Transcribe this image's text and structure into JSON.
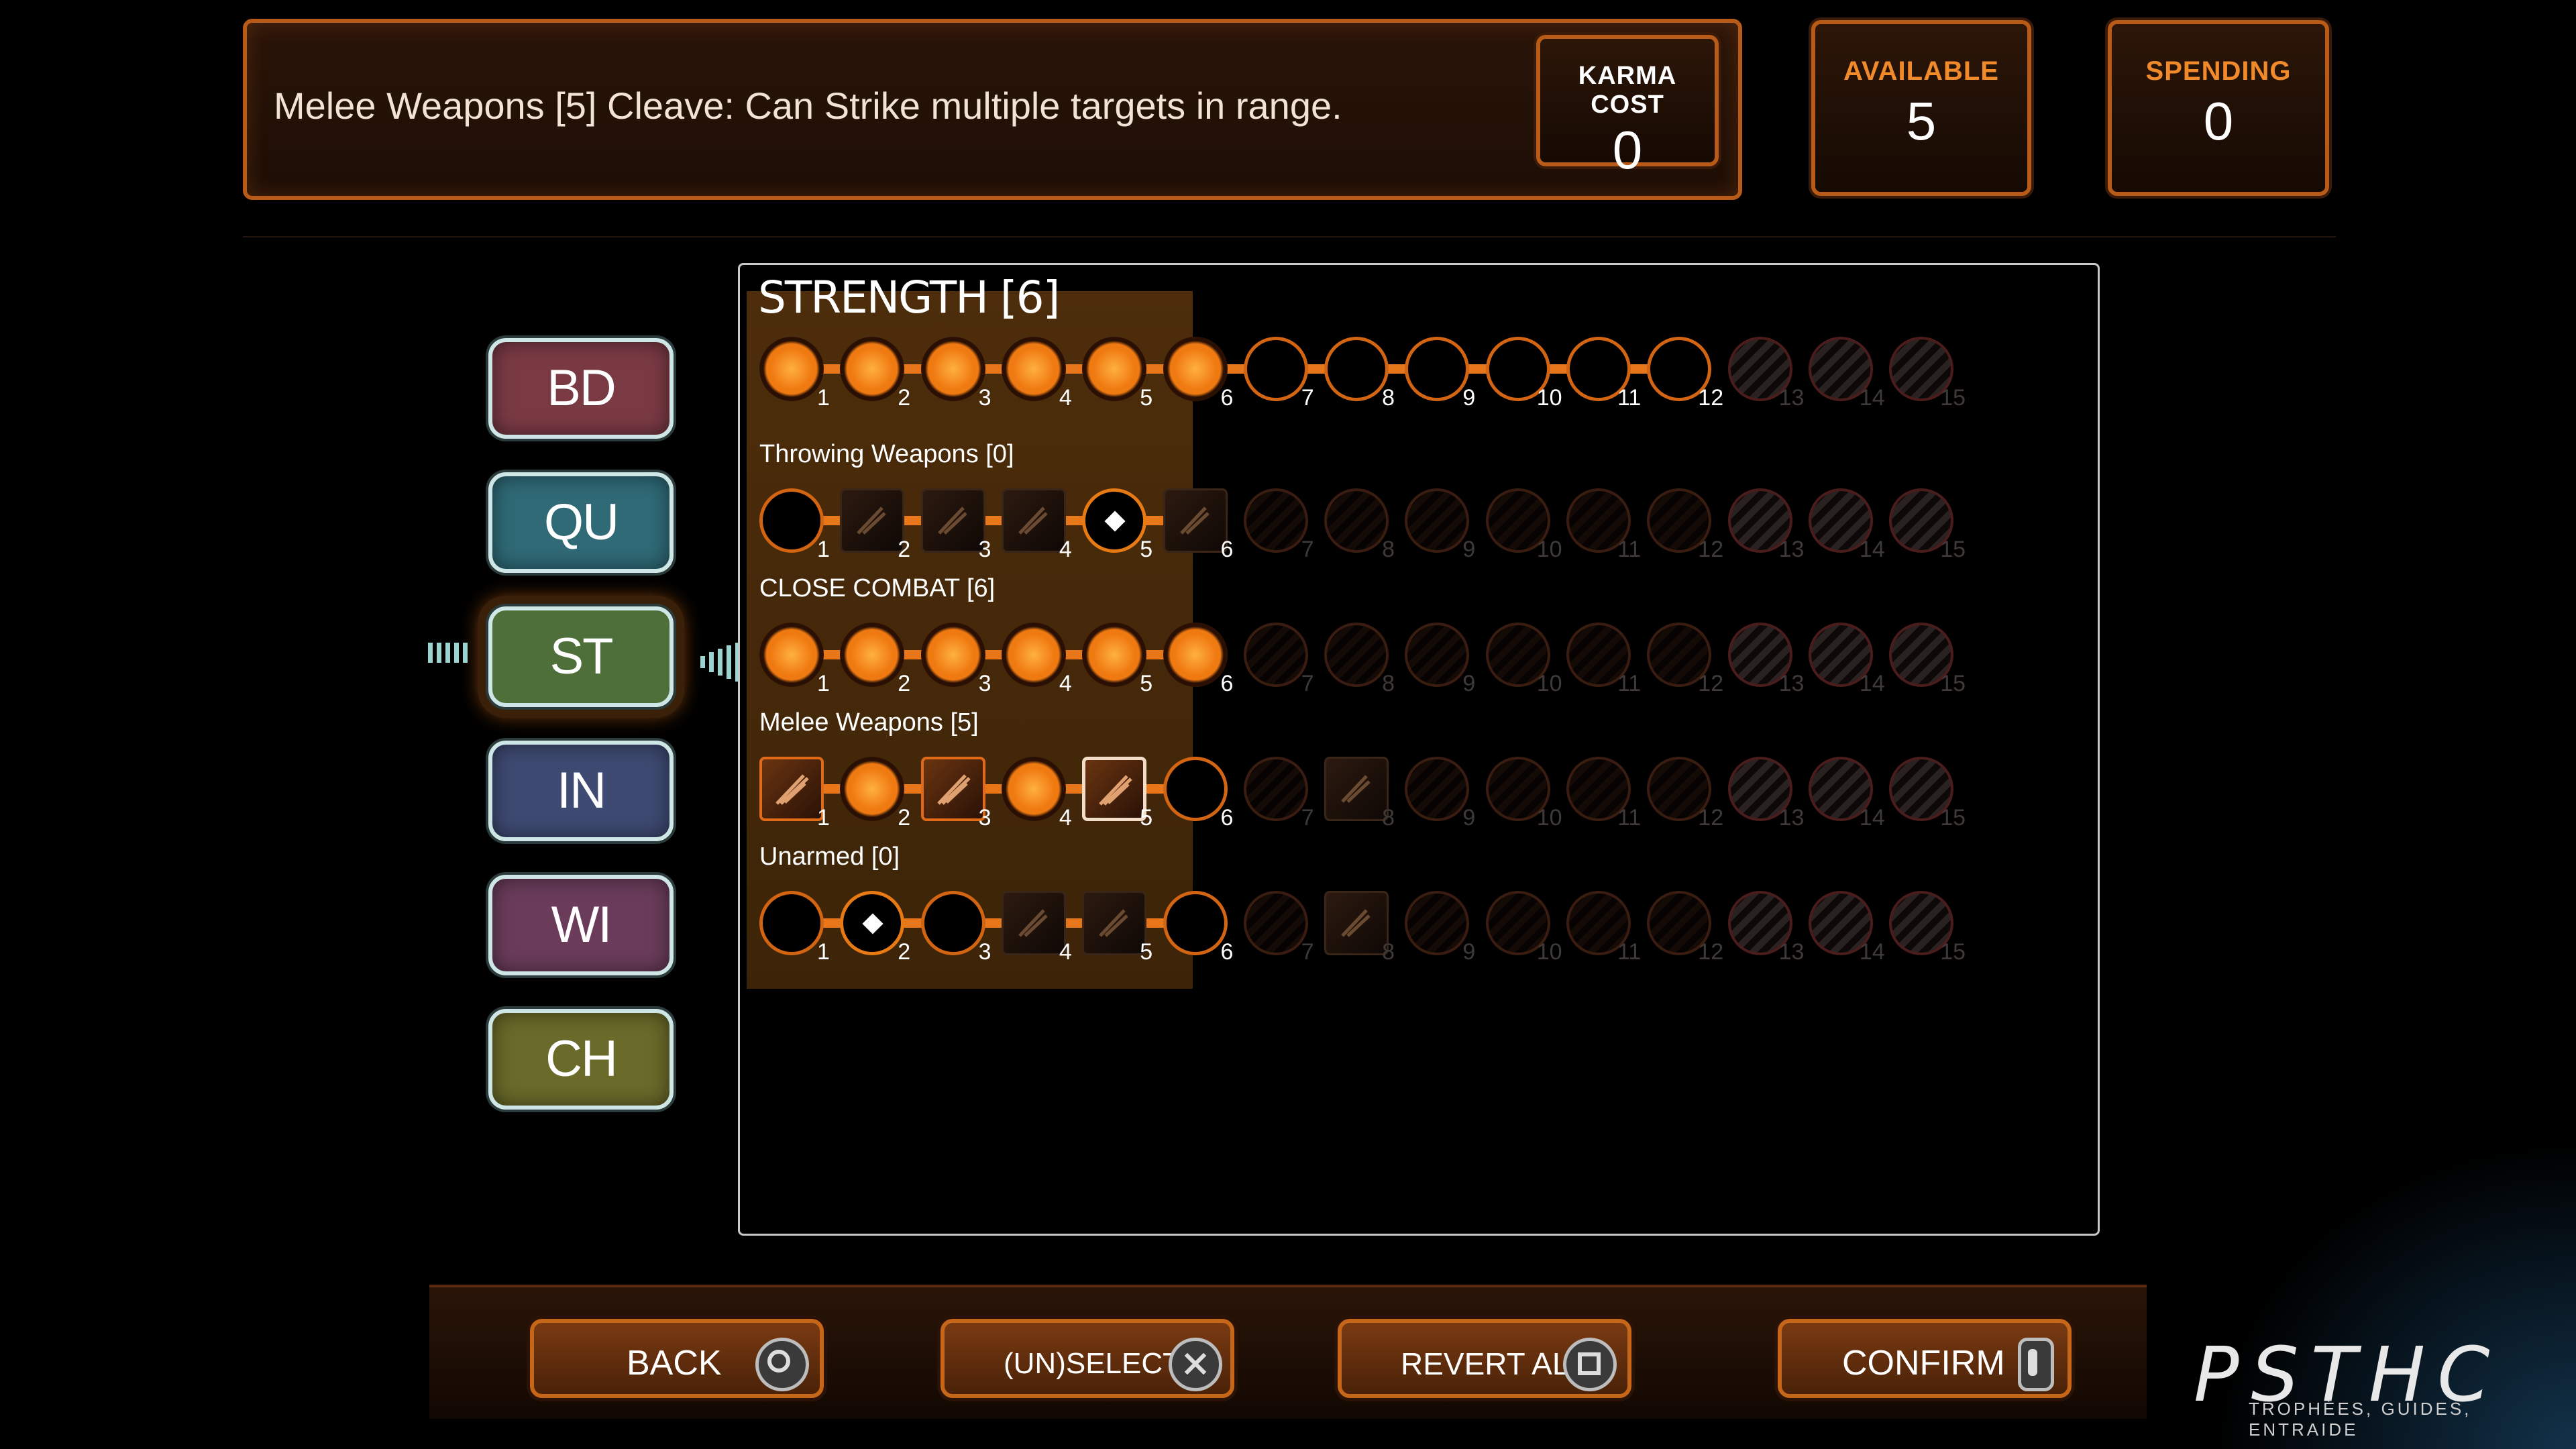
{
  "header": {
    "description": "Melee Weapons [5] Cleave: Can Strike multiple targets in range.",
    "karma_cost_label": "KARMA COST",
    "karma_cost_value": "0",
    "available_label": "AVAILABLE",
    "available_value": "5",
    "spending_label": "SPENDING",
    "spending_value": "0"
  },
  "attributes": [
    {
      "label": "BD",
      "color": "#7a3a44"
    },
    {
      "label": "QU",
      "color": "#2f6a76"
    },
    {
      "label": "ST",
      "color": "#4e6e3a",
      "selected": true
    },
    {
      "label": "IN",
      "color": "#3e4a72"
    },
    {
      "label": "WI",
      "color": "#6a3c5a"
    },
    {
      "label": "CH",
      "color": "#6a6a2a"
    }
  ],
  "panel": {
    "title": "STRENGTH [6]",
    "rows": {
      "strength": {
        "label": "",
        "value": 6
      },
      "throwing": {
        "label": "Throwing Weapons [0]",
        "value": 0
      },
      "close_combat": {
        "label": "CLOSE COMBAT [6]",
        "value": 6
      },
      "melee": {
        "label": "Melee Weapons [5]",
        "value": 5
      },
      "unarmed": {
        "label": "Unarmed [0]",
        "value": 0
      }
    },
    "level_numbers": [
      "1",
      "2",
      "3",
      "4",
      "5",
      "6",
      "7",
      "8",
      "9",
      "10",
      "11",
      "12",
      "13",
      "14",
      "15"
    ]
  },
  "buttons": {
    "back": "BACK",
    "unselect": "(UN)SELECT",
    "revert_all": "REVERT ALL",
    "confirm": "CONFIRM"
  },
  "watermark": {
    "logo": "PSTHC",
    "tagline": "TROPHÉES, GUIDES, ENTRAIDE"
  }
}
